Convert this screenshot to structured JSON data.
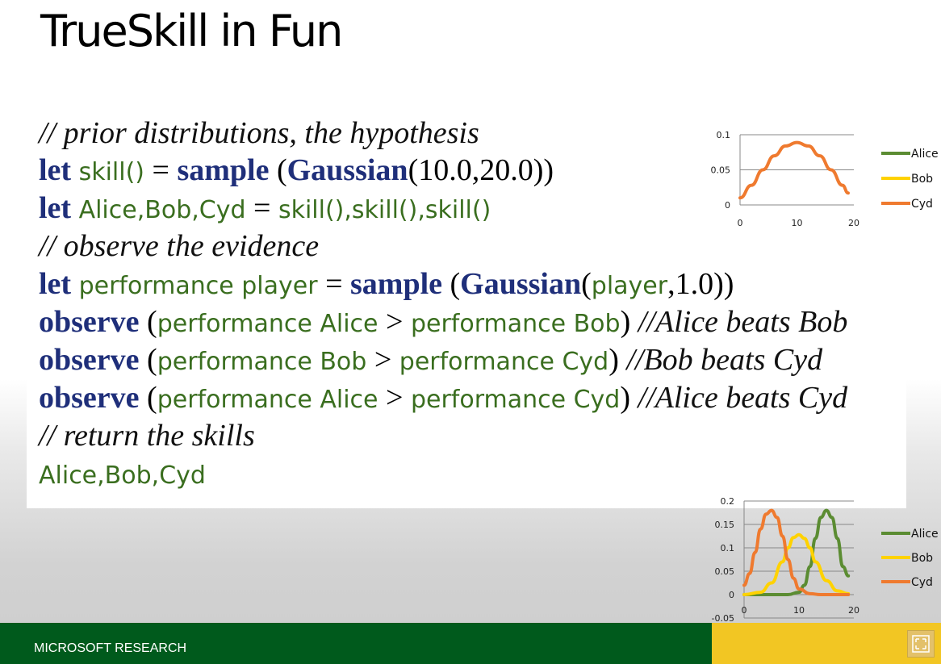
{
  "slide": {
    "title": "TrueSkill in Fun",
    "footer_text": "MICROSOFT RESEARCH"
  },
  "code": {
    "line1": {
      "comment": "// prior distributions, the hypothesis"
    },
    "line2": {
      "kw1": "let",
      "id1": "skill()",
      "op": " = ",
      "kw2": "sample",
      "p1": " (",
      "kw3": "Gaussian",
      "rest": "(10.0,20.0))"
    },
    "line3": {
      "kw1": "let",
      "id1": "Alice,Bob,Cyd",
      "op": " = ",
      "id2": "skill(),skill(),skill()"
    },
    "line4": {
      "comment": "// observe the evidence"
    },
    "line5": {
      "kw1": "let",
      "id1": "performance player",
      "op": " = ",
      "kw2": "sample",
      "p1": " (",
      "kw3": "Gaussian",
      "p2": "(",
      "id2": "player",
      "rest": ",1.0))"
    },
    "line6": {
      "kw1": "observe",
      "p1": " (",
      "id1": "performance Alice",
      "op": " > ",
      "id2": "performance Bob",
      "p2": ") ",
      "comment": "//Alice beats Bob"
    },
    "line7": {
      "kw1": "observe",
      "p1": " (",
      "id1": "performance Bob",
      "op": " > ",
      "id2": "performance Cyd",
      "p2": ") ",
      "comment": "//Bob beats Cyd"
    },
    "line8": {
      "kw1": "observe",
      "p1": " (",
      "id1": "performance Alice",
      "op": " > ",
      "id2": "performance Cyd",
      "p2": ") ",
      "comment": "//Alice beats Cyd"
    },
    "line9": {
      "comment": "// return the skills"
    },
    "line10": {
      "id1": "Alice,Bob,Cyd"
    }
  },
  "colors": {
    "alice": "#5b8c32",
    "bob": "#ffd200",
    "cyd": "#ef7a2f",
    "keyword": "#1f2f7a",
    "identifier": "#3a6e1f"
  },
  "chart_data": [
    {
      "type": "line",
      "title": "",
      "xlabel": "",
      "ylabel": "",
      "xlim": [
        0,
        20
      ],
      "ylim": [
        0,
        0.1
      ],
      "x_ticks": [
        "0",
        "10",
        "20"
      ],
      "y_ticks": [
        "0",
        "0.05",
        "0.1"
      ],
      "legend": "right",
      "series": [
        {
          "name": "Alice",
          "color": "#5b8c32",
          "points": []
        },
        {
          "name": "Bob",
          "color": "#ffd200",
          "points": []
        },
        {
          "name": "Cyd",
          "color": "#ef7a2f",
          "points": [
            [
              0,
              0.01
            ],
            [
              2,
              0.028
            ],
            [
              4,
              0.05
            ],
            [
              6,
              0.07
            ],
            [
              8,
              0.084
            ],
            [
              10,
              0.089
            ],
            [
              12,
              0.084
            ],
            [
              14,
              0.07
            ],
            [
              16,
              0.05
            ],
            [
              18,
              0.028
            ],
            [
              19,
              0.017
            ]
          ]
        }
      ]
    },
    {
      "type": "line",
      "title": "",
      "xlabel": "",
      "ylabel": "",
      "xlim": [
        0,
        20
      ],
      "ylim": [
        -0.05,
        0.2
      ],
      "x_ticks": [
        "0",
        "10",
        "20"
      ],
      "y_ticks": [
        "-0.05",
        "0",
        "0.05",
        "0.1",
        "0.15",
        "0.2"
      ],
      "legend": "right",
      "series": [
        {
          "name": "Alice",
          "color": "#5b8c32",
          "points": [
            [
              0,
              0
            ],
            [
              4,
              0
            ],
            [
              8,
              0
            ],
            [
              10,
              0.005
            ],
            [
              11,
              0.02
            ],
            [
              12,
              0.06
            ],
            [
              13,
              0.12
            ],
            [
              14,
              0.165
            ],
            [
              15,
              0.18
            ],
            [
              16,
              0.165
            ],
            [
              17,
              0.12
            ],
            [
              18,
              0.06
            ],
            [
              19,
              0.04
            ]
          ]
        },
        {
          "name": "Bob",
          "color": "#ffd200",
          "points": [
            [
              0,
              0
            ],
            [
              3,
              0.005
            ],
            [
              5,
              0.025
            ],
            [
              7,
              0.07
            ],
            [
              8,
              0.1
            ],
            [
              9,
              0.122
            ],
            [
              10,
              0.128
            ],
            [
              11,
              0.12
            ],
            [
              12,
              0.1
            ],
            [
              13,
              0.07
            ],
            [
              15,
              0.03
            ],
            [
              17,
              0.008
            ],
            [
              19,
              0.002
            ]
          ]
        },
        {
          "name": "Cyd",
          "color": "#ef7a2f",
          "points": [
            [
              0,
              0.02
            ],
            [
              1,
              0.045
            ],
            [
              2,
              0.09
            ],
            [
              3,
              0.14
            ],
            [
              4,
              0.172
            ],
            [
              5,
              0.18
            ],
            [
              6,
              0.165
            ],
            [
              7,
              0.125
            ],
            [
              8,
              0.075
            ],
            [
              9,
              0.035
            ],
            [
              10,
              0.012
            ],
            [
              12,
              0.002
            ],
            [
              14,
              0
            ],
            [
              19,
              0
            ]
          ]
        }
      ]
    }
  ]
}
